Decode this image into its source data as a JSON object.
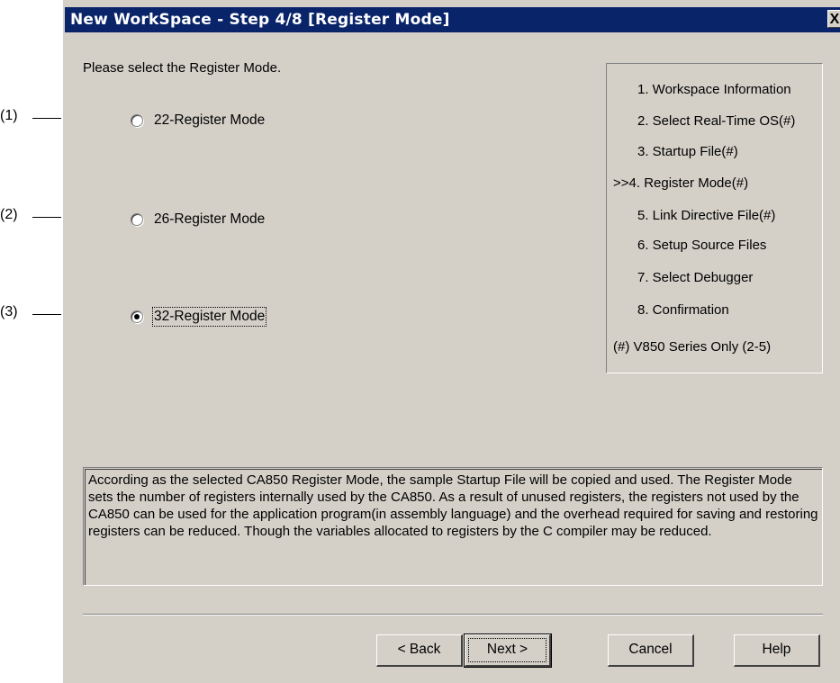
{
  "window": {
    "title": "New WorkSpace - Step 4/8 [Register Mode]",
    "close_label": "X"
  },
  "prompt": "Please select the Register Mode.",
  "callouts": [
    "(1)",
    "(2)",
    "(3)"
  ],
  "register_options": [
    {
      "label": "22-Register Mode",
      "checked": false
    },
    {
      "label": "26-Register Mode",
      "checked": false
    },
    {
      "label": "32-Register Mode",
      "checked": true
    }
  ],
  "steps": [
    "1. Workspace Information",
    "2. Select Real-Time OS(#)",
    "3. Startup File(#)",
    ">>4. Register Mode(#)",
    "5. Link Directive File(#)",
    "6. Setup Source Files",
    "7. Select Debugger",
    "8. Confirmation"
  ],
  "steps_note": "(#) V850 Series Only (2-5)",
  "description": "According as the selected CA850 Register Mode, the sample Startup File will be copied and used. The Register Mode sets the number of registers internally used by the CA850. As a result of unused registers, the registers not used by the CA850 can be used for the application program(in assembly language) and the overhead required for saving and restoring registers can be reduced. Though the variables allocated to registers by the C compiler may be reduced.",
  "buttons": {
    "back": "< Back",
    "next": "Next >",
    "cancel": "Cancel",
    "help": "Help"
  }
}
